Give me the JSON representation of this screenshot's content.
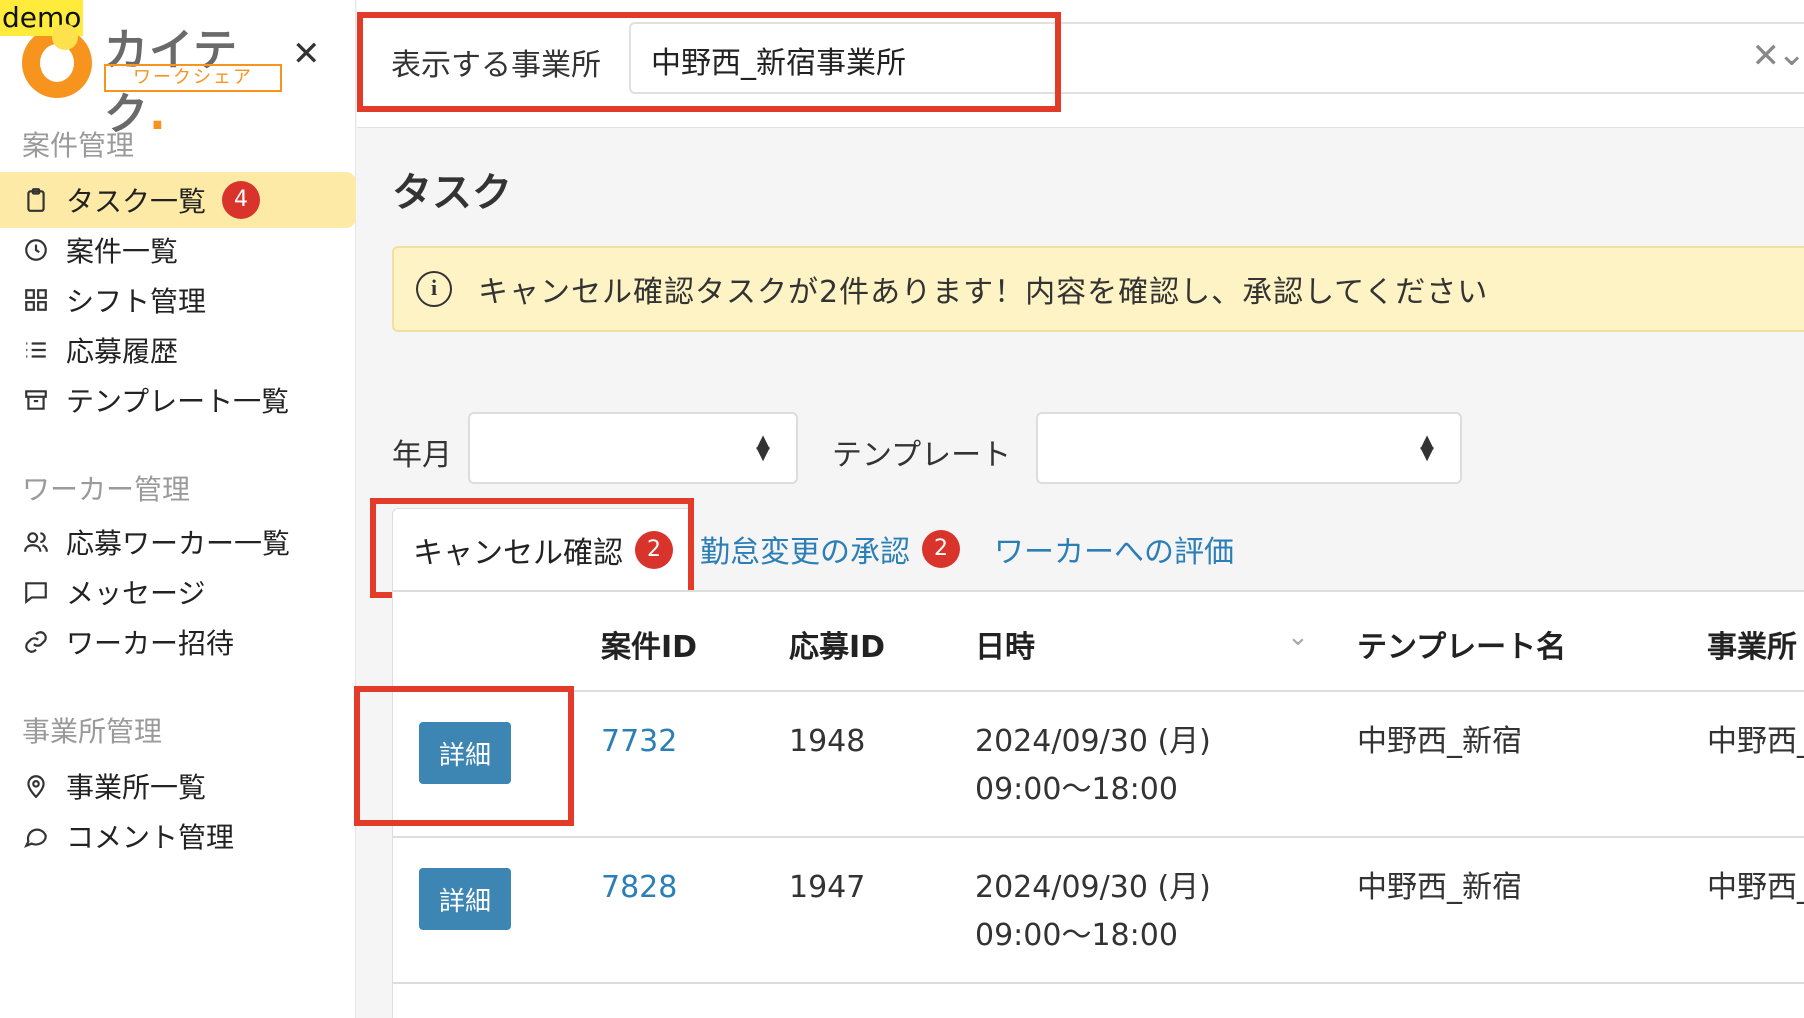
{
  "demo_tag": "demo",
  "logo": {
    "name": "カイテク",
    "suffix": ".",
    "sub": "ワークシェア"
  },
  "sidebar": {
    "sections": [
      {
        "title": "案件管理"
      },
      {
        "title": "ワーカー管理"
      },
      {
        "title": "事業所管理"
      }
    ],
    "items": [
      {
        "label": "タスク一覧",
        "icon": "clipboard-icon",
        "badge": "4",
        "active": true
      },
      {
        "label": "案件一覧",
        "icon": "clock-icon"
      },
      {
        "label": "シフト管理",
        "icon": "grid-icon"
      },
      {
        "label": "応募履歴",
        "icon": "list-icon"
      },
      {
        "label": "テンプレート一覧",
        "icon": "archive-icon"
      },
      {
        "label": "応募ワーカー一覧",
        "icon": "users-icon"
      },
      {
        "label": "メッセージ",
        "icon": "message-icon"
      },
      {
        "label": "ワーカー招待",
        "icon": "link-icon"
      },
      {
        "label": "事業所一覧",
        "icon": "map-pin-icon"
      },
      {
        "label": "コメント管理",
        "icon": "comment-icon"
      }
    ]
  },
  "topbar": {
    "office_label": "表示する事業所",
    "office_value": "中野西_新宿事業所"
  },
  "main": {
    "title": "タスク",
    "alert": "キャンセル確認タスクが2件あります！内容を確認し、承認してください",
    "filters": {
      "month_label": "年月",
      "template_label": "テンプレート"
    },
    "tabs": [
      {
        "label": "キャンセル確認",
        "badge": "2",
        "active": true
      },
      {
        "label": "勤怠変更の承認",
        "badge": "2"
      },
      {
        "label": "ワーカーへの評価"
      }
    ],
    "table": {
      "headers": [
        "案件ID",
        "応募ID",
        "日時",
        "テンプレート名",
        "事業所"
      ],
      "detail_label": "詳細",
      "rows": [
        {
          "job_id": "7732",
          "app_id": "1948",
          "date": "2024/09/30 (月)",
          "time": "09:00〜18:00",
          "template": "中野西_新宿",
          "office": "中野西_"
        },
        {
          "job_id": "7828",
          "app_id": "1947",
          "date": "2024/09/30 (月)",
          "time": "09:00〜18:00",
          "template": "中野西_新宿",
          "office": "中野西_"
        }
      ]
    }
  },
  "colors": {
    "accent": "#f7941d",
    "link": "#2b7fb6",
    "badge": "#d9342b",
    "highlight": "#e33b2a",
    "active_nav": "#fdeaa6",
    "button": "#3d86b3"
  }
}
